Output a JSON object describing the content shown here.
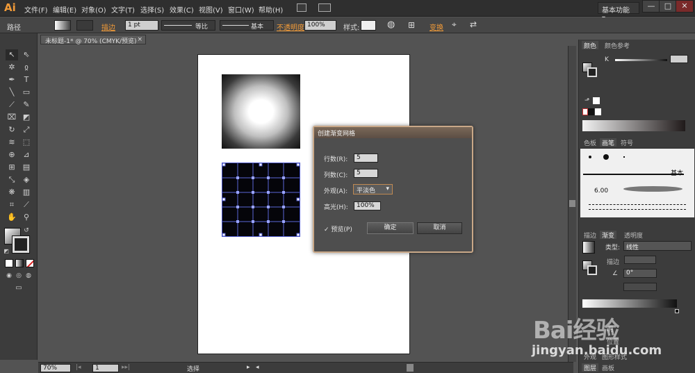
{
  "app": {
    "logo": "Ai"
  },
  "menu": [
    "文件(F)",
    "编辑(E)",
    "对象(O)",
    "文字(T)",
    "选择(S)",
    "效果(C)",
    "视图(V)",
    "窗口(W)",
    "帮助(H)"
  ],
  "workspace": "基本功能",
  "window_controls": {
    "minimize": "—",
    "restore": "□",
    "close": "✕"
  },
  "controlbar": {
    "object_type": "路径",
    "stroke_label": "描边",
    "stroke_weight": "1 pt",
    "profile_label": "等比",
    "brush_label": "基本",
    "opacity_label": "不透明度",
    "opacity_value": "100%",
    "style_label": "样式:",
    "transform_label": "变换"
  },
  "document_tab": {
    "title": "未标题-1* @ 70% (CMYK/预览)",
    "close": "×"
  },
  "dialog": {
    "title": "创建渐变网格",
    "rows_label": "行数(R):",
    "rows_value": "5",
    "cols_label": "列数(C):",
    "cols_value": "5",
    "appearance_label": "外观(A):",
    "appearance_value": "平淡色",
    "highlight_label": "高光(H):",
    "highlight_value": "100%",
    "preview_label": "预览(P)",
    "preview_checked": true,
    "ok_label": "确定",
    "cancel_label": "取消"
  },
  "color_panel": {
    "tabs": [
      "颜色",
      "颜色参考"
    ],
    "channel_label": "K"
  },
  "brush_panel": {
    "tabs": [
      "色板",
      "画笔",
      "符号"
    ],
    "basic_label": "基本",
    "size_value": "6.00"
  },
  "gradient_panel": {
    "tabs": [
      "描边",
      "渐变",
      "透明度"
    ],
    "type_label": "类型:",
    "type_value": "线性",
    "stroke_label": "描边",
    "angle_value": "0°",
    "partial_labels": [
      "明",
      "位置"
    ]
  },
  "bottom_tabs": {
    "row1": [
      "外观",
      "图形样式"
    ],
    "row2": [
      "图层",
      "画板"
    ]
  },
  "statusbar": {
    "zoom": "70%",
    "page": "1",
    "status_text": "选择"
  },
  "watermark": {
    "logo": "Bai经验",
    "url": "jingyan.baidu.com"
  }
}
